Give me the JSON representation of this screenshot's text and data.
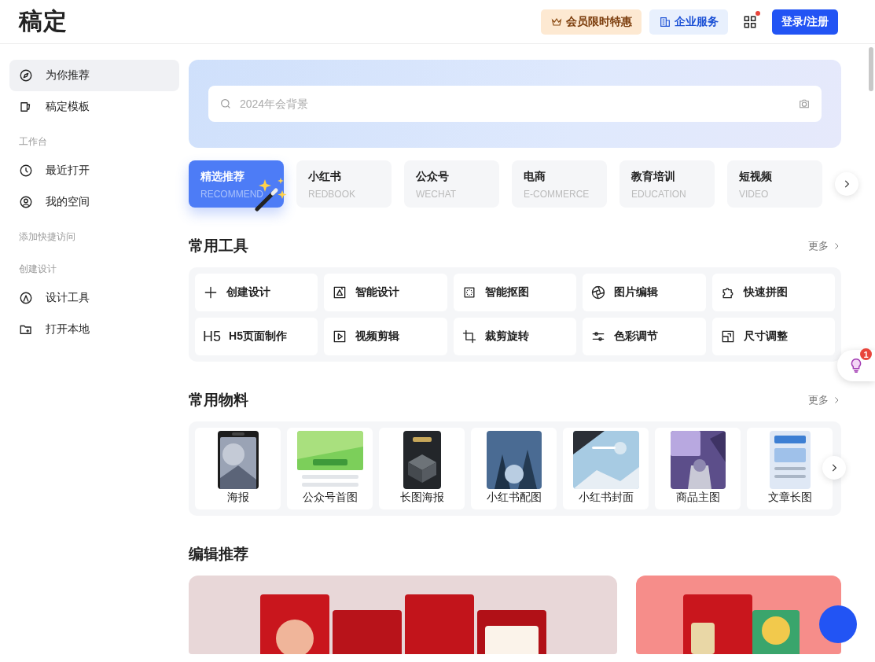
{
  "header": {
    "logo": "稿定",
    "vip_button": "会员限时特惠",
    "enterprise_button": "企业服务",
    "apps_notification": true,
    "login_button": "登录/注册"
  },
  "sidebar": {
    "items": [
      {
        "kind": "item",
        "label": "为你推荐",
        "selected": true
      },
      {
        "kind": "item",
        "label": "稿定模板",
        "selected": false
      },
      {
        "kind": "heading",
        "label": "工作台"
      },
      {
        "kind": "item",
        "label": "最近打开",
        "selected": false
      },
      {
        "kind": "item",
        "label": "我的空间",
        "selected": false
      },
      {
        "kind": "heading",
        "label": "添加快捷访问"
      },
      {
        "kind": "heading",
        "label": "创建设计"
      },
      {
        "kind": "item",
        "label": "设计工具",
        "selected": false
      },
      {
        "kind": "item",
        "label": "打开本地",
        "selected": false
      }
    ]
  },
  "search": {
    "placeholder": "2024年会背景"
  },
  "categories": [
    {
      "label": "精选推荐",
      "sublabel": "RECOMMEND",
      "selected": true
    },
    {
      "label": "小红书",
      "sublabel": "REDBOOK",
      "selected": false
    },
    {
      "label": "公众号",
      "sublabel": "WECHAT",
      "selected": false
    },
    {
      "label": "电商",
      "sublabel": "E-COMMERCE",
      "selected": false
    },
    {
      "label": "教育培训",
      "sublabel": "EDUCATION",
      "selected": false
    },
    {
      "label": "短视频",
      "sublabel": "VIDEO",
      "selected": false
    }
  ],
  "tools": {
    "title": "常用工具",
    "more": "更多",
    "items": [
      {
        "label": "创建设计"
      },
      {
        "label": "智能设计"
      },
      {
        "label": "智能抠图"
      },
      {
        "label": "图片编辑"
      },
      {
        "label": "快速拼图"
      },
      {
        "label": "H5页面制作",
        "glyph": "H5"
      },
      {
        "label": "视频剪辑"
      },
      {
        "label": "裁剪旋转"
      },
      {
        "label": "色彩调节"
      },
      {
        "label": "尺寸调整"
      }
    ]
  },
  "materials": {
    "title": "常用物料",
    "more": "更多",
    "items": [
      {
        "label": "海报"
      },
      {
        "label": "公众号首图"
      },
      {
        "label": "长图海报"
      },
      {
        "label": "小红书配图"
      },
      {
        "label": "小红书封面"
      },
      {
        "label": "商品主图"
      },
      {
        "label": "文章长图"
      }
    ]
  },
  "editor_picks": {
    "title": "编辑推荐"
  },
  "assistant": {
    "badge": "1"
  }
}
